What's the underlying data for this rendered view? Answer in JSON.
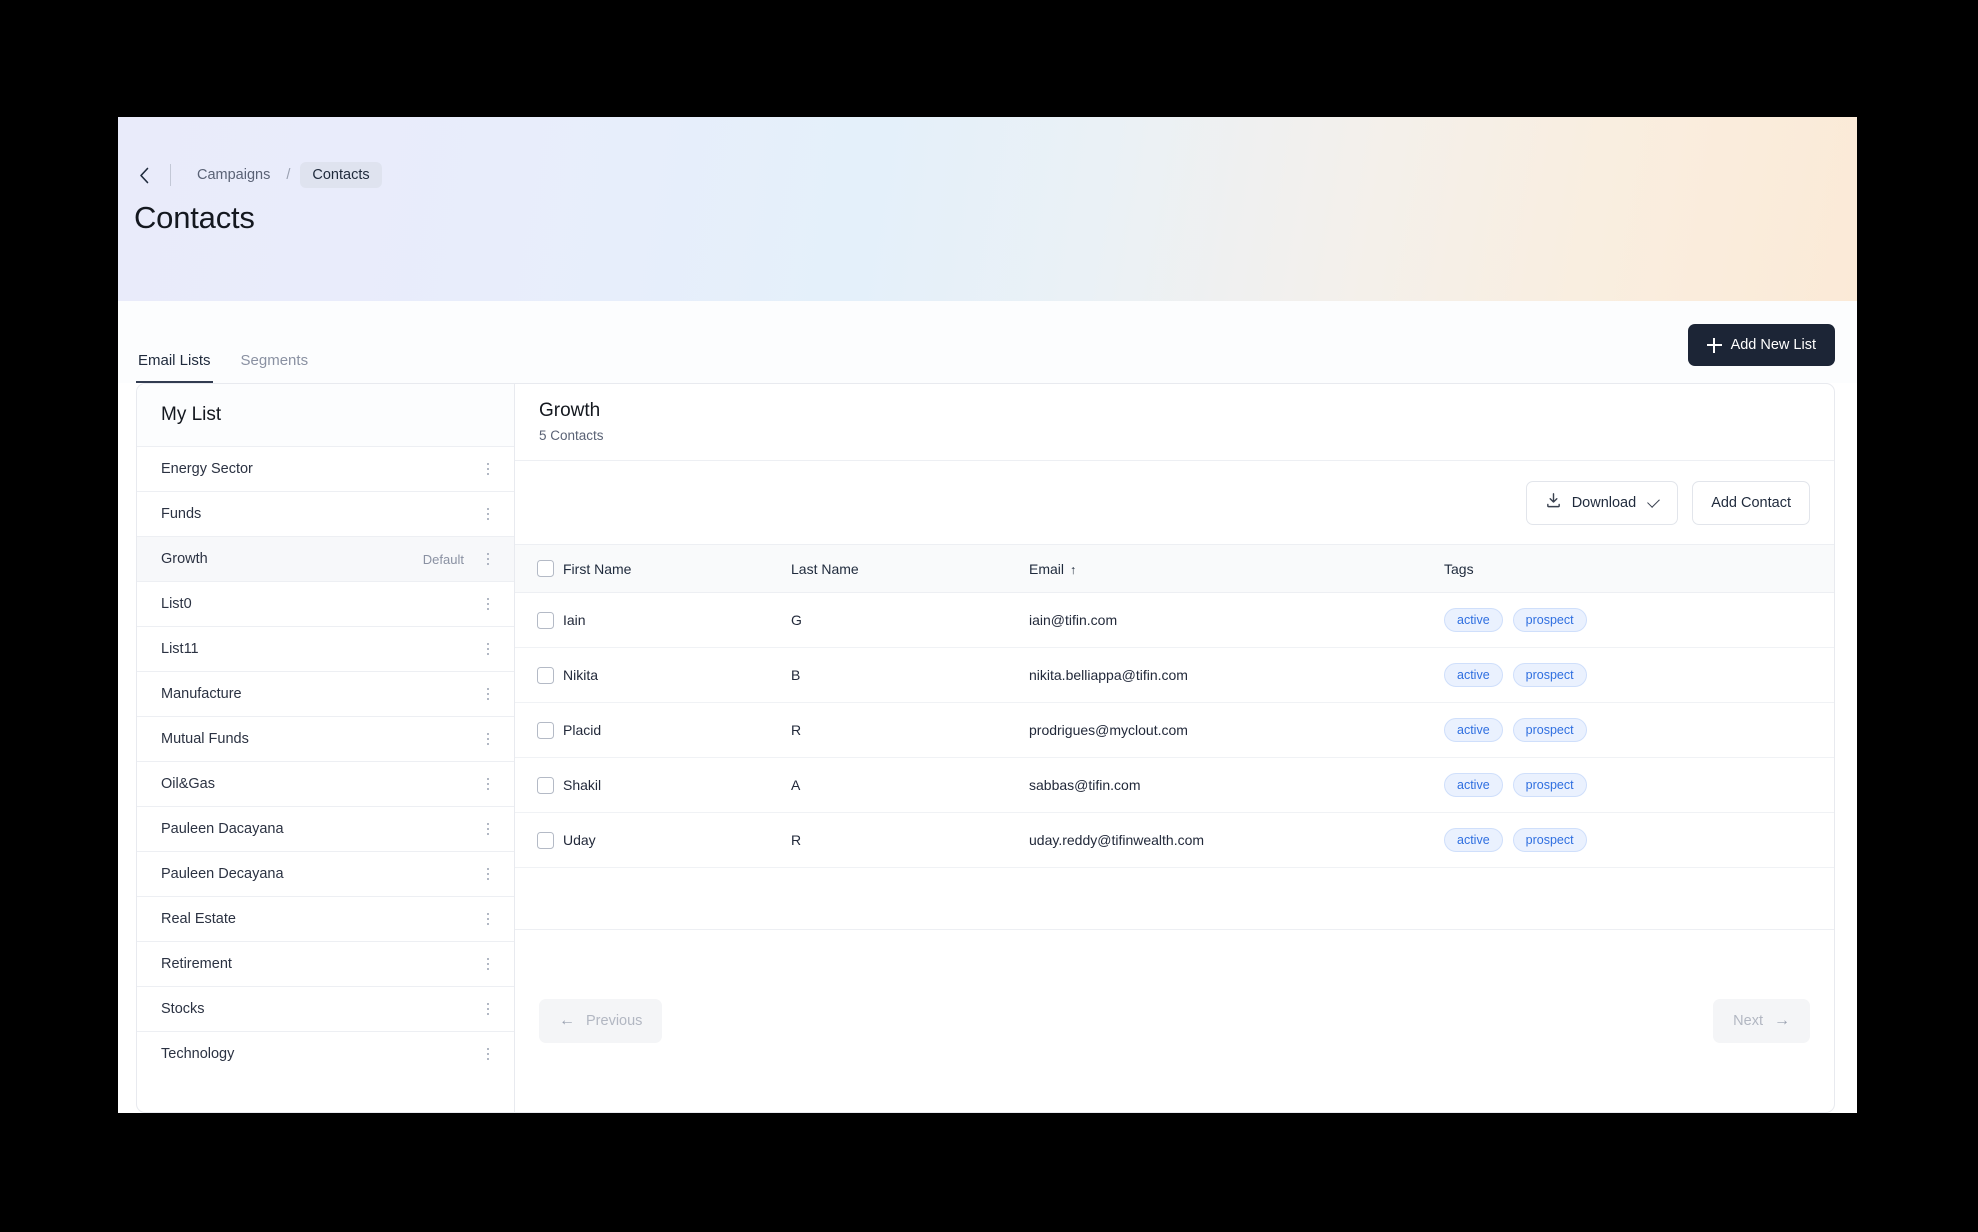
{
  "header": {
    "back_icon": "chevron-left-icon",
    "breadcrumb": {
      "parent": "Campaigns",
      "separator": "/",
      "current": "Contacts"
    },
    "title": "Contacts"
  },
  "tabs": [
    {
      "label": "Email Lists",
      "active": true
    },
    {
      "label": "Segments",
      "active": false
    }
  ],
  "toolbar": {
    "add_new_list_label": "Add New List",
    "add_new_list_icon": "plus-icon"
  },
  "sidebar": {
    "heading": "My List",
    "items": [
      {
        "label": "Energy Sector",
        "badge": "",
        "selected": false
      },
      {
        "label": "Funds",
        "badge": "",
        "selected": false
      },
      {
        "label": "Growth",
        "badge": "Default",
        "selected": true
      },
      {
        "label": "List0",
        "badge": "",
        "selected": false
      },
      {
        "label": "List11",
        "badge": "",
        "selected": false
      },
      {
        "label": "Manufacture",
        "badge": "",
        "selected": false
      },
      {
        "label": "Mutual Funds",
        "badge": "",
        "selected": false
      },
      {
        "label": "Oil&Gas",
        "badge": "",
        "selected": false
      },
      {
        "label": "Pauleen Dacayana",
        "badge": "",
        "selected": false
      },
      {
        "label": "Pauleen Decayana",
        "badge": "",
        "selected": false
      },
      {
        "label": "Real Estate",
        "badge": "",
        "selected": false
      },
      {
        "label": "Retirement",
        "badge": "",
        "selected": false
      },
      {
        "label": "Stocks",
        "badge": "",
        "selected": false
      },
      {
        "label": "Technology",
        "badge": "",
        "selected": false
      }
    ]
  },
  "main": {
    "list_name": "Growth",
    "contacts_count_label": "5 Contacts",
    "download_label": "Download",
    "download_icon": "download-icon",
    "download_chevron_icon": "chevron-down-icon",
    "add_contact_label": "Add Contact",
    "columns": {
      "first_name": "First Name",
      "last_name": "Last Name",
      "email": "Email",
      "email_sort_indicator": "↑",
      "tags": "Tags"
    },
    "rows": [
      {
        "first_name": "Iain",
        "last_name": "G",
        "email": "iain@tifin.com",
        "tags": [
          "active",
          "prospect"
        ]
      },
      {
        "first_name": "Nikita",
        "last_name": "B",
        "email": "nikita.belliappa@tifin.com",
        "tags": [
          "active",
          "prospect"
        ]
      },
      {
        "first_name": "Placid",
        "last_name": "R",
        "email": "prodrigues@myclout.com",
        "tags": [
          "active",
          "prospect"
        ]
      },
      {
        "first_name": "Shakil",
        "last_name": "A",
        "email": "sabbas@tifin.com",
        "tags": [
          "active",
          "prospect"
        ]
      },
      {
        "first_name": "Uday",
        "last_name": "R",
        "email": "uday.reddy@tifinwealth.com",
        "tags": [
          "active",
          "prospect"
        ]
      }
    ],
    "pagination": {
      "previous_label": "Previous",
      "next_label": "Next",
      "previous_icon": "arrow-left-icon",
      "next_icon": "arrow-right-icon"
    }
  },
  "colors": {
    "accent_dark": "#1c2536",
    "tag_text": "#2f6fe0",
    "tag_bg": "#eaf1fe",
    "header_gradient_start": "#e9ebfa",
    "header_gradient_end": "#fbead7"
  }
}
